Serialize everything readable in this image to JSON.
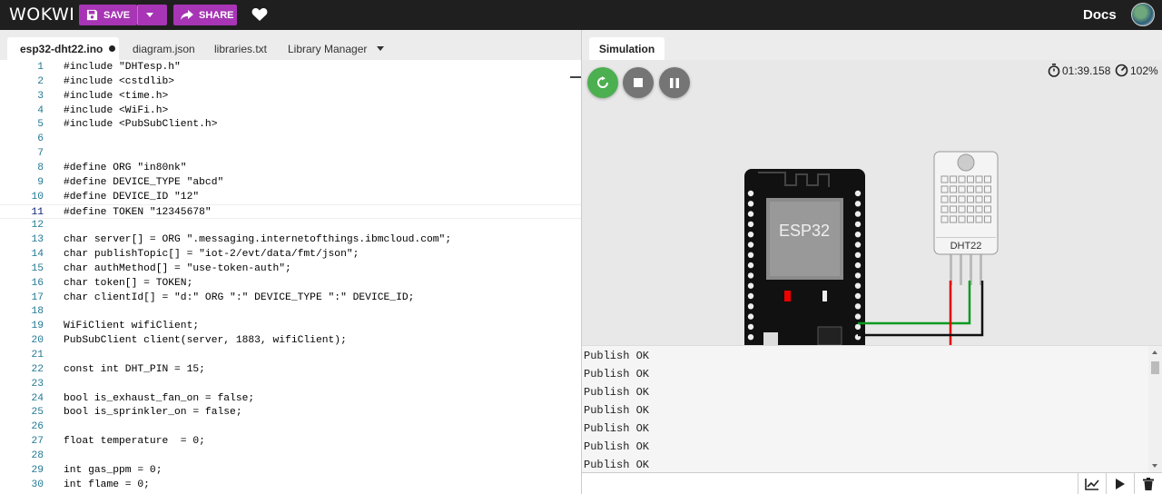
{
  "app": {
    "logo": "WOKWI",
    "docs_label": "Docs"
  },
  "toolbar": {
    "save_label": "SAVE",
    "share_label": "SHARE"
  },
  "editor": {
    "tabs": [
      {
        "label": "esp32-dht22.ino",
        "active": true,
        "modified": true
      },
      {
        "label": "diagram.json"
      },
      {
        "label": "libraries.txt"
      },
      {
        "label": "Library Manager"
      }
    ],
    "current_line": 11,
    "lines": [
      "#include \"DHTesp.h\"",
      "#include <cstdlib>",
      "#include <time.h>",
      "#include <WiFi.h>",
      "#include <PubSubClient.h>",
      "",
      "",
      "#define ORG \"in80nk\"",
      "#define DEVICE_TYPE \"abcd\"",
      "#define DEVICE_ID \"12\"",
      "#define TOKEN \"12345678\"",
      "",
      "char server[] = ORG \".messaging.internetofthings.ibmcloud.com\";",
      "char publishTopic[] = \"iot-2/evt/data/fmt/json\";",
      "char authMethod[] = \"use-token-auth\";",
      "char token[] = TOKEN;",
      "char clientId[] = \"d:\" ORG \":\" DEVICE_TYPE \":\" DEVICE_ID;",
      "",
      "WiFiClient wifiClient;",
      "PubSubClient client(server, 1883, wifiClient);",
      "",
      "const int DHT_PIN = 15;",
      "",
      "bool is_exhaust_fan_on = false;",
      "bool is_sprinkler_on = false;",
      "",
      "float temperature  = 0;",
      "",
      "int gas_ppm = 0;",
      "int flame = 0;"
    ]
  },
  "simulation": {
    "tab_label": "Simulation",
    "timer": "01:39.158",
    "speed": "102%",
    "esp32_label": "ESP32",
    "dht_label": "DHT22",
    "colors": {
      "accent": "#a735b5",
      "restart": "#4caf50",
      "wire_green": "#0a9a1e",
      "wire_red": "#e00000",
      "wire_black": "#111111"
    }
  },
  "serial": {
    "lines": [
      "Publish OK",
      "Publish OK",
      "Publish OK",
      "Publish OK",
      "Publish OK",
      "Publish OK",
      "Publish OK"
    ],
    "input_value": ""
  }
}
